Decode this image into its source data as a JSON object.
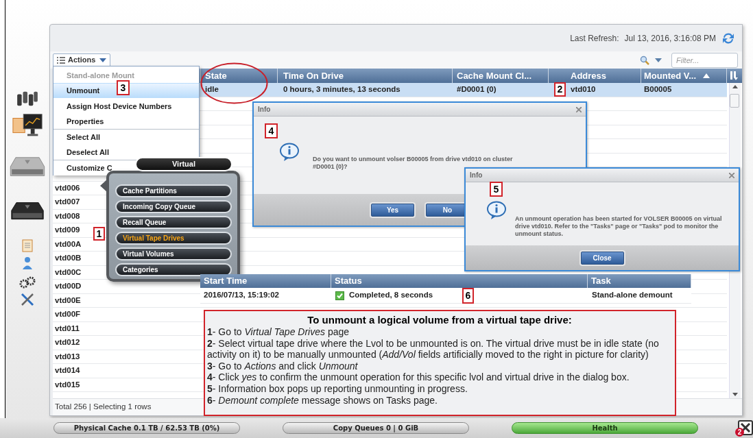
{
  "header": {
    "last_refresh_label": "Last Refresh:",
    "last_refresh": "Jul 13, 2016, 3:16:08 PM"
  },
  "toolbar": {
    "actions": "Actions",
    "filter_placeholder": "Filter..."
  },
  "actions_menu": {
    "items": [
      {
        "label": "Stand-alone Mount",
        "disabled": true,
        "selected": false,
        "divider_above": false
      },
      {
        "label": "Unmount",
        "disabled": false,
        "selected": true,
        "divider_above": false
      },
      {
        "label": "Assign Host Device Numbers",
        "disabled": false,
        "selected": false,
        "divider_above": false
      },
      {
        "label": "Properties",
        "disabled": false,
        "selected": false,
        "divider_above": false
      },
      {
        "label": "Select All",
        "disabled": false,
        "selected": false,
        "divider_above": true
      },
      {
        "label": "Deselect All",
        "disabled": false,
        "selected": false,
        "divider_above": false
      },
      {
        "label": "Customize C",
        "disabled": false,
        "selected": false,
        "divider_above": true
      }
    ]
  },
  "table": {
    "columns": [
      {
        "label": "State",
        "sorted_ascending": false
      },
      {
        "label": "Time On Drive",
        "sorted_ascending": false
      },
      {
        "label": "Cache Mount Cl...",
        "sorted_ascending": false
      },
      {
        "label": "Address",
        "sorted_ascending": false
      },
      {
        "label": "Mounted V...",
        "sorted_ascending": true
      }
    ],
    "rows": [
      {
        "selected": true,
        "cells": [
          "idle",
          "0 hours, 3 minutes, 13 seconds",
          "#D0001 (0)",
          "vtd010",
          "B00005"
        ]
      },
      {
        "selected": false,
        "name": "vtd006"
      },
      {
        "selected": false,
        "name": "vtd007"
      },
      {
        "selected": false,
        "name": "vtd008"
      },
      {
        "selected": false,
        "name": "vtd009"
      },
      {
        "selected": false,
        "name": "vtd00A"
      },
      {
        "selected": false,
        "name": "vtd00B"
      },
      {
        "selected": false,
        "name": "vtd00C"
      },
      {
        "selected": false,
        "name": "vtd00D"
      },
      {
        "selected": false,
        "name": "vtd00E"
      },
      {
        "selected": false,
        "name": "vtd00F"
      },
      {
        "selected": false,
        "name": "vtd011"
      },
      {
        "selected": false,
        "name": "vtd012"
      },
      {
        "selected": false,
        "name": "vtd013"
      },
      {
        "selected": false,
        "name": "vtd014"
      },
      {
        "selected": false,
        "name": "vtd015"
      }
    ],
    "footer": "Total 256 | Selecting 1 rows"
  },
  "virtual_menu": {
    "title": "Virtual",
    "items": [
      {
        "label": "Cache Partitions",
        "selected": false
      },
      {
        "label": "Incoming Copy Queue",
        "selected": false
      },
      {
        "label": "Recall Queue",
        "selected": false
      },
      {
        "label": "Virtual Tape Drives",
        "selected": true
      },
      {
        "label": "Virtual Volumes",
        "selected": false
      },
      {
        "label": "Categories",
        "selected": false
      }
    ]
  },
  "dialogs": [
    {
      "title": "Info",
      "message": "Do you want to unmount volser B00005 from drive vtd010 on cluster\n#D0001 (0)?",
      "buttons": [
        "Yes",
        "No"
      ]
    },
    {
      "title": "Info",
      "message": "An unmount operation has been started for VOLSER B00005 on virtual\ndrive vtd010. Refer to the \"Tasks\" page or \"Tasks\" pod to monitor the\nunmount status.",
      "buttons": [
        "Close"
      ]
    }
  ],
  "tasks": {
    "columns": [
      "Start Time",
      "Status",
      "Task"
    ],
    "rows": [
      {
        "start_time": "2016/07/13, 15:19:02",
        "status": "Completed, 8 seconds",
        "completed": true,
        "task": "Stand-alone demount"
      }
    ]
  },
  "callout": {
    "title": "To unmount a logical volume from a virtual tape drive:",
    "steps": [
      "**1**- Go to *Virtual Tape Drives* page",
      "**2**- Select virtual tape drive where the Lvol to be unmounted is on. The virtual drive must be in idle state (no activity on it) to be manually unmounted (*Add/Vol* fields artificially moved to the right in picture for clarity)",
      "**3**-  Go to *Actions* and click *Unmount*",
      "**4**- Click *yes* to confirm the unmount operation for this specific lvol and virtual drive in the dialog box.",
      "**5**- Information box pops up reporting unmounting in progress.",
      "**6**- *Demount complete* message shows on Tasks page."
    ]
  },
  "annotations": [
    "1",
    "2",
    "3",
    "4",
    "5",
    "6"
  ],
  "status_bar": [
    {
      "label": "Physical Cache 0.1 TB / 62.53 TB (0%)",
      "healthy": false
    },
    {
      "label": "Copy Queues 0 | 0 GiB",
      "healthy": false
    },
    {
      "label": "Health",
      "healthy": true
    }
  ],
  "notification_count": "2"
}
